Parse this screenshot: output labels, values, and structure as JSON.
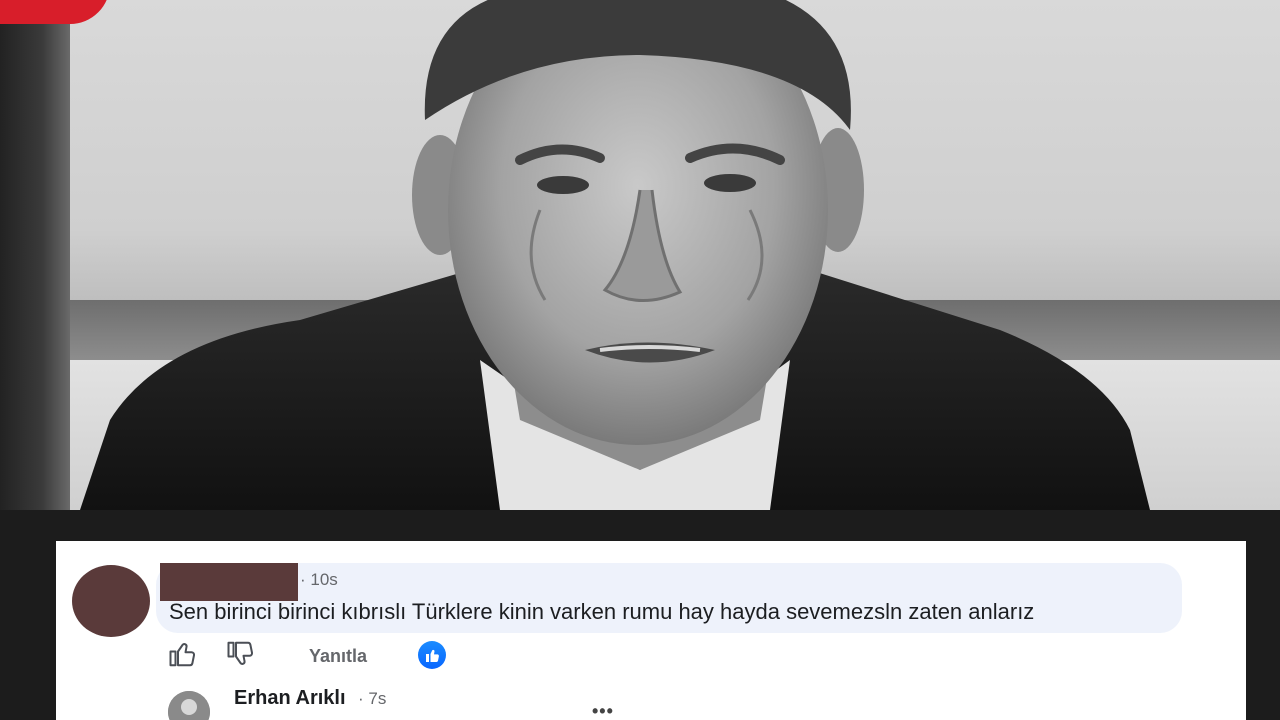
{
  "comment": {
    "time": "10s",
    "text": "Sen birinci birinci kıbrıslı Türklere kinin varken rumu hay hayda sevemezsln zaten anlarız",
    "actions": {
      "reply_label": "Yanıtla"
    }
  },
  "reply": {
    "author": "Erhan Arıklı",
    "time": "7s"
  },
  "colors": {
    "brand_red": "#d81e2a",
    "bubble_bg": "#eef2fb",
    "like_blue": "#0866ff",
    "muted_text": "#65676b"
  },
  "icons": [
    "thumbs-up-icon",
    "thumbs-down-icon",
    "like-reaction-icon",
    "more-options-icon"
  ]
}
